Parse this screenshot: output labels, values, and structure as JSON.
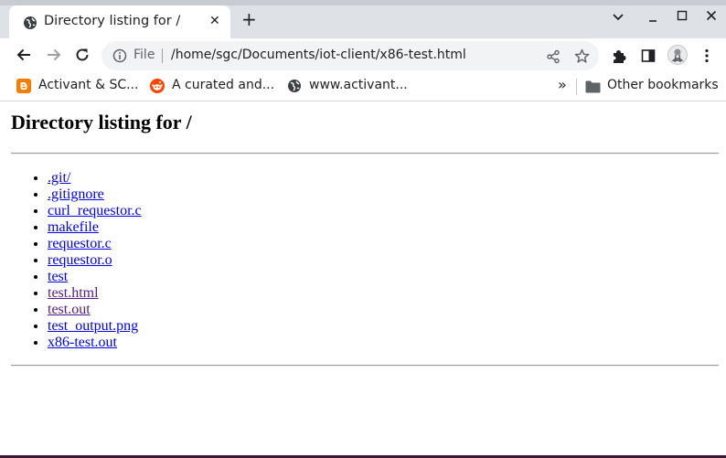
{
  "tab": {
    "title": "Directory listing for /",
    "icon": "globe-icon"
  },
  "toolbar": {
    "scheme": "File",
    "url": "/home/sgc/Documents/iot-client/x86-test.html"
  },
  "bookmarks": {
    "items": [
      {
        "label": "Activant & SC...",
        "icon": "blogger-icon",
        "color": "#f57d00"
      },
      {
        "label": "A curated and...",
        "icon": "reddit-icon",
        "color": "#ff4500"
      },
      {
        "label": "www.activant...",
        "icon": "globe-icon"
      }
    ],
    "overflow": "»",
    "other": "Other bookmarks"
  },
  "page": {
    "heading": "Directory listing for /",
    "files": [
      {
        "name": ".git/",
        "visited": false
      },
      {
        "name": ".gitignore",
        "visited": false
      },
      {
        "name": "curl_requestor.c",
        "visited": false
      },
      {
        "name": "makefile",
        "visited": false
      },
      {
        "name": "requestor.c",
        "visited": false
      },
      {
        "name": "requestor.o",
        "visited": false
      },
      {
        "name": "test",
        "visited": false
      },
      {
        "name": "test.html",
        "visited": true
      },
      {
        "name": "test.out",
        "visited": true
      },
      {
        "name": "test_output.png",
        "visited": false
      },
      {
        "name": "x86-test.out",
        "visited": false
      }
    ]
  },
  "colors": {
    "link": "#0000ee",
    "visited": "#551a8b",
    "frame": "#dee1e6"
  }
}
